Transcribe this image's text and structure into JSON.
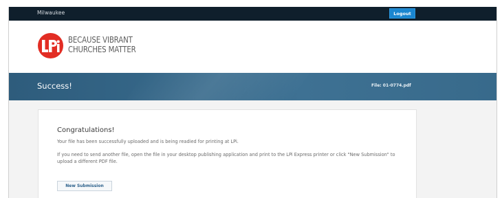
{
  "topbar": {
    "location": "Milwaukee",
    "logout_label": "Logout"
  },
  "header": {
    "logo_icon": "lpi-logo-icon",
    "tagline_line1": "BECAUSE VIBRANT",
    "tagline_line2": "CHURCHES MATTER",
    "brand_color": "#e22d24"
  },
  "banner": {
    "title": "Success!",
    "file_label": "File: 01-0774.pdf"
  },
  "card": {
    "title": "Congratulations!",
    "message1": "Your file has been successfully uploaded and is being readied for printing at LPi.",
    "message2": "If you need to send another file, open the file in your desktop publishing application and print to the LPi Express printer or click \"New Submission\" to upload a different PDF file.",
    "new_submission_label": "New Submission"
  },
  "colors": {
    "topbar": "#0f1f2c",
    "accent": "#1a86d0",
    "banner": "#386b8d"
  }
}
